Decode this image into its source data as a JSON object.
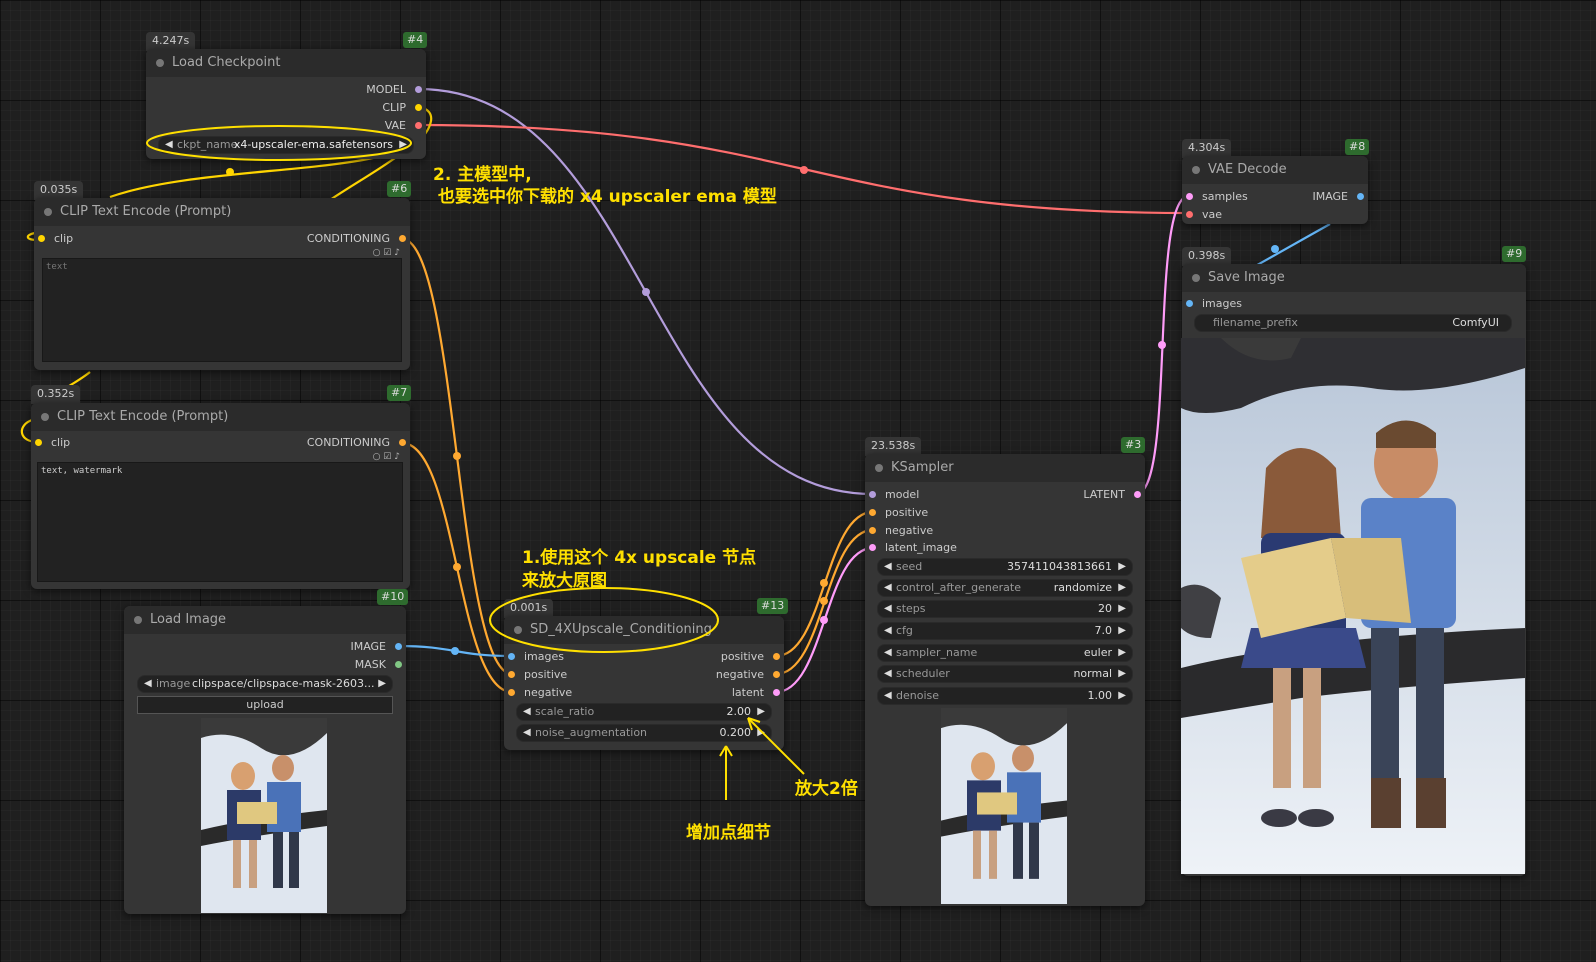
{
  "colors": {
    "model": "#b39ddb",
    "clip": "#ffd500",
    "vae": "#ff6e6e",
    "conditioning": "#ffa931",
    "latent": "#ff9cf9",
    "image": "#64b5f6",
    "mask": "#81c784",
    "annotation": "#ffe000"
  },
  "nodes": {
    "load_checkpoint": {
      "timing": "4.247s",
      "id": "#4",
      "title": "Load Checkpoint",
      "outputs": [
        "MODEL",
        "CLIP",
        "VAE"
      ],
      "widget_label": "ckpt_name",
      "widget_value": "x4-upscaler-ema.safetensors"
    },
    "clip_pos": {
      "timing": "0.035s",
      "id": "#6",
      "title": "CLIP Text Encode (Prompt)",
      "input": "clip",
      "output": "CONDITIONING",
      "text": "text"
    },
    "clip_neg": {
      "timing": "0.352s",
      "id": "#7",
      "title": "CLIP Text Encode (Prompt)",
      "input": "clip",
      "output": "CONDITIONING",
      "text": "text, watermark"
    },
    "load_image": {
      "id": "#10",
      "title": "Load Image",
      "outputs": [
        "IMAGE",
        "MASK"
      ],
      "widget_label": "image",
      "widget_value": "clipspace/clipspace-mask-2603...",
      "upload_label": "upload"
    },
    "upscale": {
      "timing": "0.001s",
      "id": "#13",
      "title": "SD_4XUpscale_Conditioning",
      "inputs": [
        "images",
        "positive",
        "negative"
      ],
      "outputs": [
        "positive",
        "negative",
        "latent"
      ],
      "widgets": [
        {
          "label": "scale_ratio",
          "value": "2.00"
        },
        {
          "label": "noise_augmentation",
          "value": "0.200"
        }
      ]
    },
    "ksampler": {
      "timing": "23.538s",
      "id": "#3",
      "title": "KSampler",
      "inputs": [
        "model",
        "positive",
        "negative",
        "latent_image"
      ],
      "output": "LATENT",
      "widgets": [
        {
          "label": "seed",
          "value": "357411043813661"
        },
        {
          "label": "control_after_generate",
          "value": "randomize"
        },
        {
          "label": "steps",
          "value": "20"
        },
        {
          "label": "cfg",
          "value": "7.0"
        },
        {
          "label": "sampler_name",
          "value": "euler"
        },
        {
          "label": "scheduler",
          "value": "normal"
        },
        {
          "label": "denoise",
          "value": "1.00"
        }
      ]
    },
    "vae_decode": {
      "timing": "4.304s",
      "id": "#8",
      "title": "VAE Decode",
      "inputs": [
        "samples",
        "vae"
      ],
      "output": "IMAGE"
    },
    "save_image": {
      "timing": "0.398s",
      "id": "#9",
      "title": "Save Image",
      "input": "images",
      "widget_label": "filename_prefix",
      "widget_value": "ComfyUI"
    }
  },
  "annotations": {
    "a2_line1": "2. 主模型中,",
    "a2_line2": "也要选中你下载的 x4 upscaler ema 模型",
    "a1_line1": "1.使用这个 4x upscale 节点",
    "a1_line2": "来放大原图",
    "scale_note": "放大2倍",
    "detail_note": "增加点细节"
  }
}
